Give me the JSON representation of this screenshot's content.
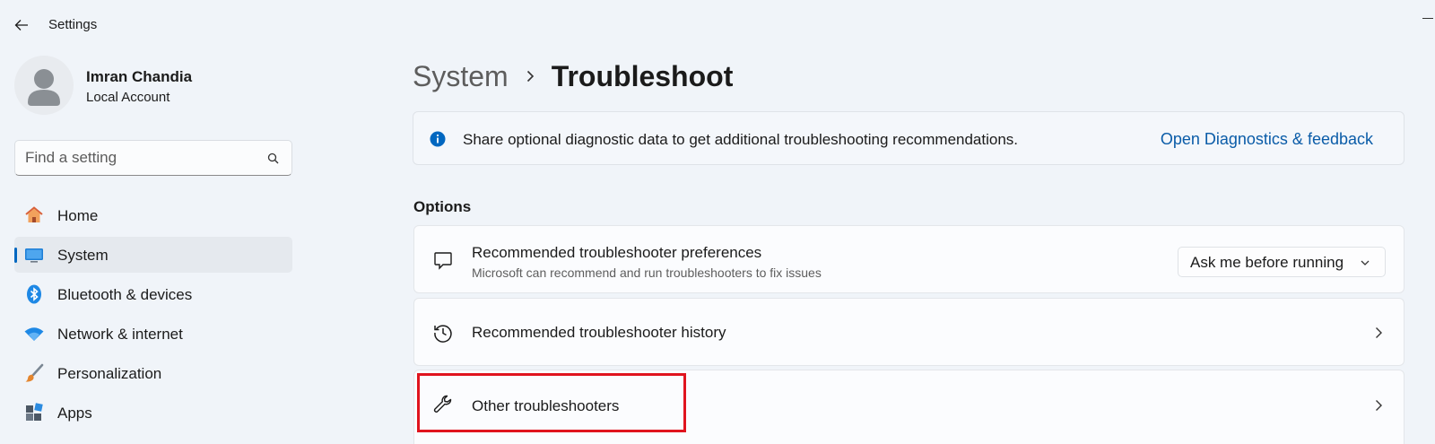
{
  "window": {
    "title": "Settings"
  },
  "user": {
    "name": "Imran Chandia",
    "account_type": "Local Account"
  },
  "search": {
    "placeholder": "Find a setting",
    "value": ""
  },
  "sidebar": {
    "items": [
      {
        "label": "Home",
        "icon": "home-icon",
        "active": false
      },
      {
        "label": "System",
        "icon": "system-icon",
        "active": true
      },
      {
        "label": "Bluetooth & devices",
        "icon": "bluetooth-icon",
        "active": false
      },
      {
        "label": "Network & internet",
        "icon": "wifi-icon",
        "active": false
      },
      {
        "label": "Personalization",
        "icon": "paintbrush-icon",
        "active": false
      },
      {
        "label": "Apps",
        "icon": "apps-icon",
        "active": false
      }
    ]
  },
  "breadcrumb": {
    "parent": "System",
    "current": "Troubleshoot"
  },
  "info_bar": {
    "text": "Share optional diagnostic data to get additional troubleshooting recommendations.",
    "link": "Open Diagnostics & feedback"
  },
  "options": {
    "title": "Options",
    "cards": [
      {
        "title": "Recommended troubleshooter preferences",
        "subtitle": "Microsoft can recommend and run troubleshooters to fix issues",
        "icon": "chat-bubble-icon",
        "dropdown_value": "Ask me before running"
      },
      {
        "title": "Recommended troubleshooter history",
        "icon": "history-icon"
      },
      {
        "title": "Other troubleshooters",
        "icon": "wrench-icon"
      }
    ]
  },
  "colors": {
    "accent": "#0067c0",
    "link": "#0a5ca8",
    "highlight_box": "#e0141e",
    "background": "#f0f4f9"
  }
}
